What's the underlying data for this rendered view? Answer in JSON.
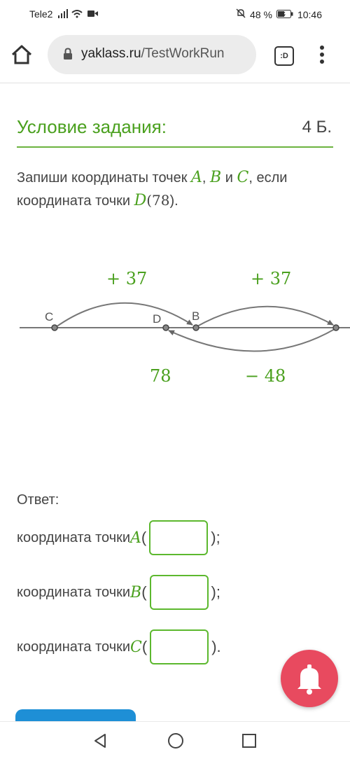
{
  "status_bar": {
    "carrier": "Tele2",
    "battery": "48 %",
    "time": "10:46"
  },
  "browser": {
    "url_domain": "yaklass.ru",
    "url_path": "/TestWorkRun",
    "tabs_label": ":D"
  },
  "task": {
    "title": "Условие задания:",
    "points": "4 Б.",
    "statement": {
      "text1": "Запиши координаты точек ",
      "A": "A",
      "comma": ", ",
      "B": "B",
      "and": " и ",
      "C": "C",
      "text2": ", если координата точки ",
      "D": "D",
      "open": "(",
      "D_value": "78",
      "close": ")."
    }
  },
  "diagram": {
    "top_left_label": "+ 37",
    "top_right_label": "+ 37",
    "bottom_left_label": "78",
    "bottom_right_label": "− 48",
    "point_c": "C",
    "point_d": "D",
    "point_b": "B"
  },
  "answer": {
    "label": "Ответ:",
    "rows": [
      {
        "prefix": "координата точки ",
        "point": "A",
        "open": "(",
        "close": ");"
      },
      {
        "prefix": "координата точки ",
        "point": "B",
        "open": "(",
        "close": ");"
      },
      {
        "prefix": "координата точки ",
        "point": "C",
        "open": "(",
        "close": ")."
      }
    ]
  },
  "colors": {
    "accent_green": "#4aa01e",
    "bell_red": "#e84a5f",
    "submit_blue": "#1e8fd6"
  }
}
